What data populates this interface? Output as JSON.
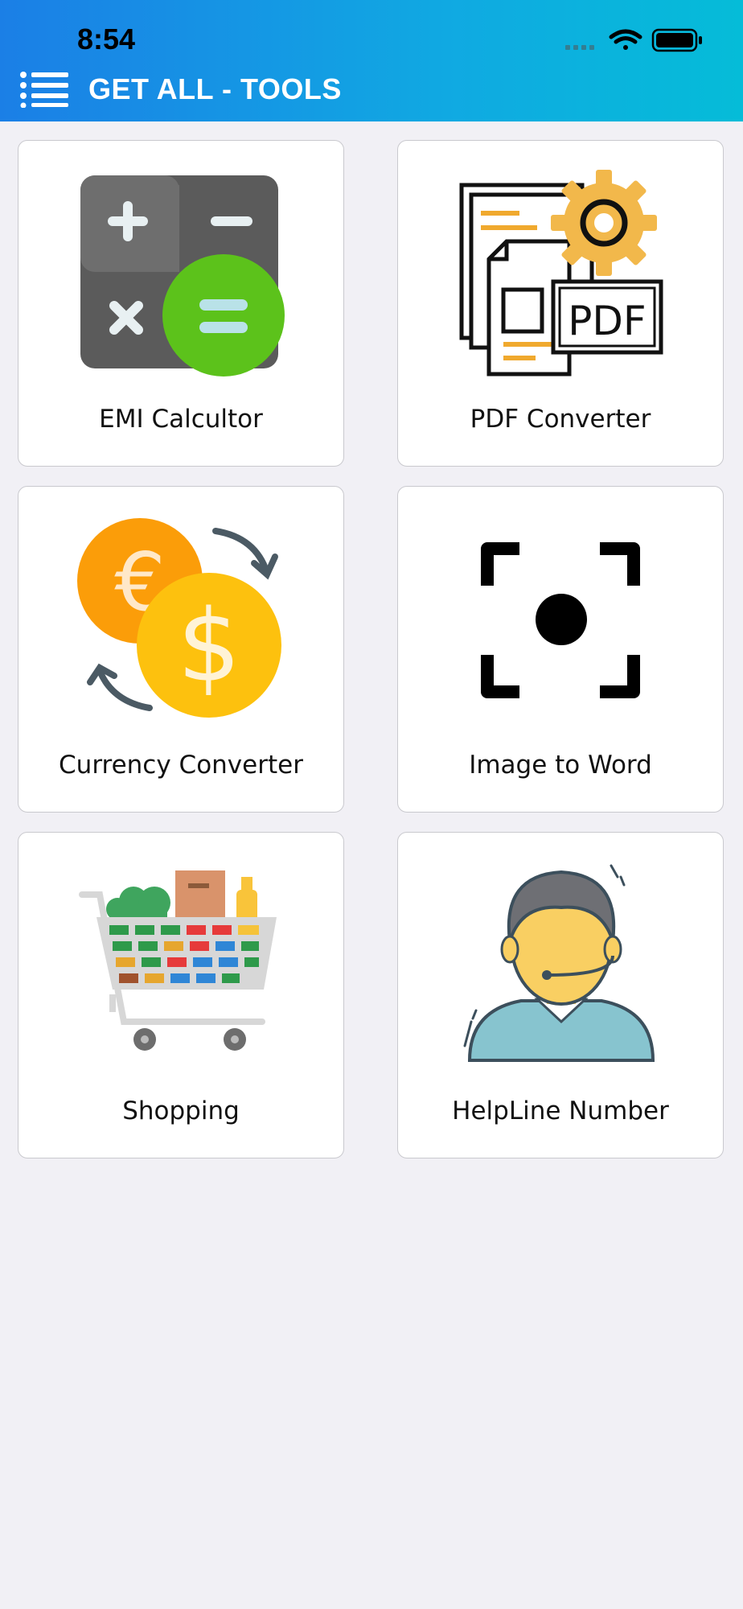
{
  "status_bar": {
    "time": "8:54"
  },
  "header": {
    "title": "GET ALL - TOOLS"
  },
  "tools": [
    {
      "label": "EMI Calcultor",
      "icon": "calculator-icon"
    },
    {
      "label": "PDF Converter",
      "icon": "pdf-gear-icon"
    },
    {
      "label": "Currency Converter",
      "icon": "currency-exchange-icon"
    },
    {
      "label": "Image to Word",
      "icon": "focus-scan-icon"
    },
    {
      "label": "Shopping",
      "icon": "shopping-cart-icon"
    },
    {
      "label": "HelpLine Number",
      "icon": "support-agent-icon"
    }
  ],
  "colors": {
    "header_gradient_start": "#1b7fe6",
    "header_gradient_end": "#05bcd8",
    "background": "#f1f0f5"
  }
}
